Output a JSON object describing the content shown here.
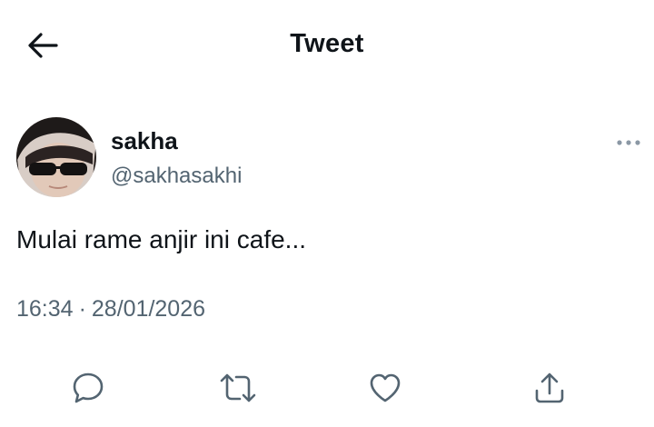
{
  "header": {
    "title": "Tweet",
    "back_icon": "arrow-left-icon"
  },
  "tweet": {
    "display_name": "sakha",
    "handle": "@sakhasakhi",
    "text": "Mulai rame anjir ini cafe...",
    "time": "16:34",
    "separator": "·",
    "date": "28/01/2026",
    "more_icon": "more-horizontal-icon"
  },
  "actions": [
    {
      "name": "reply",
      "icon": "reply-icon"
    },
    {
      "name": "retweet",
      "icon": "retweet-icon"
    },
    {
      "name": "like",
      "icon": "heart-icon"
    },
    {
      "name": "share",
      "icon": "share-icon"
    }
  ],
  "colors": {
    "text_primary": "#0f1419",
    "text_secondary": "#536471",
    "background": "#ffffff"
  }
}
